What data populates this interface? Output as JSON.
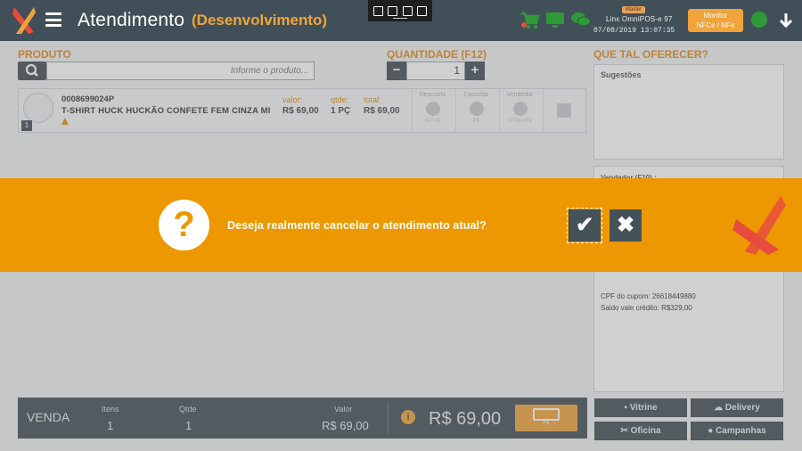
{
  "header": {
    "title": "Atendimento",
    "environment": "(Desenvolvimento)",
    "badge": "Master",
    "pos_name": "Linx OmniPOS-e 97",
    "datetime": "07/08/2019 13:07:35",
    "monitor_line1": "Monitor",
    "monitor_line2": "NFCe / NFe"
  },
  "product": {
    "label": "PRODUTO",
    "search_placeholder": "Informe o produto..."
  },
  "quantity": {
    "label": "QUANTIDADE (F12)",
    "value": "1",
    "minus": "−",
    "plus": "+"
  },
  "item": {
    "index": "1",
    "code": "0008699024P",
    "description": "T-SHIRT HUCK HUCKÃO CONFETE FEM CINZA MI",
    "valor_label": "valor:",
    "valor": "R$ 69,00",
    "qtde_label": "qtde:",
    "qtde": "1 PÇ",
    "total_label": "total:",
    "total": "R$ 69,00",
    "actions": [
      {
        "label": "Desconto",
        "key": "ALT+D"
      },
      {
        "label": "Cancelar",
        "key": "F5"
      },
      {
        "label": "Vendedor",
        "key": "CTRL+F5"
      }
    ]
  },
  "suggest": {
    "label": "QUE TAL OFERECER?",
    "box_title": "Sugestões"
  },
  "seller": {
    "title": "Vendedor (F10) :"
  },
  "customer": {
    "cpf_label": "CPF do cupom:",
    "cpf": "26618449880",
    "credit_label": "Saldo vale crédito:",
    "credit": "R$329,00"
  },
  "footer": {
    "venda": "VENDA",
    "itens_label": "Itens",
    "itens": "1",
    "qtde_label": "Qtde",
    "qtde": "1",
    "valor_label": "Valor",
    "valor": "R$ 69,00",
    "total": "R$ 69,00",
    "pay_key": "F8"
  },
  "side_buttons": {
    "vitrine": "Vitrine",
    "delivery": "Delivery",
    "oficina": "Oficina",
    "campanhas": "Campanhas"
  },
  "dialog": {
    "icon": "?",
    "message": "Deseja realmente cancelar o atendimento atual?",
    "confirm": "✔",
    "cancel": "✖"
  },
  "colors": {
    "header_bg": "#415058",
    "accent": "#f0a43a",
    "dialog_bg": "#ed9800"
  }
}
